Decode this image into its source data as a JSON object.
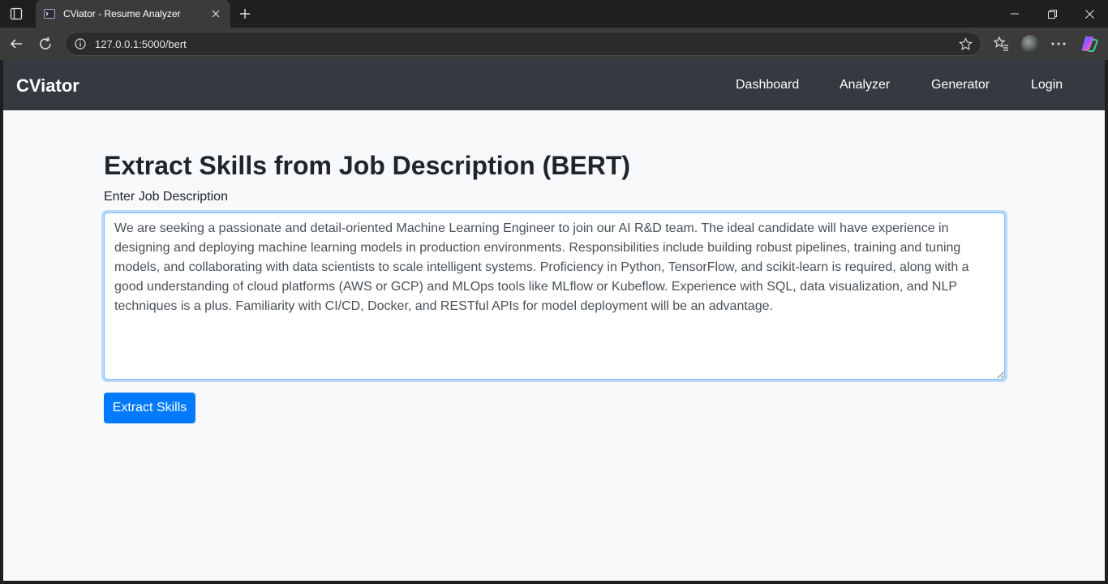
{
  "browser": {
    "tab_title": "CViator - Resume Analyzer",
    "url": "127.0.0.1:5000/bert"
  },
  "navbar": {
    "brand": "CViator",
    "links": [
      "Dashboard",
      "Analyzer",
      "Generator",
      "Login"
    ]
  },
  "page": {
    "heading": "Extract Skills from Job Description (BERT)",
    "textarea_label": "Enter Job Description",
    "job_description": "We are seeking a passionate and detail-oriented Machine Learning Engineer to join our AI R&D team. The ideal candidate will have experience in designing and deploying machine learning models in production environments. Responsibilities include building robust pipelines, training and tuning models, and collaborating with data scientists to scale intelligent systems. Proficiency in Python, TensorFlow, and scikit-learn is required, along with a good understanding of cloud platforms (AWS or GCP) and MLOps tools like MLflow or Kubeflow. Experience with SQL, data visualization, and NLP techniques is a plus. Familiarity with CI/CD, Docker, and RESTful APIs for model deployment will be an advantage.",
    "submit_label": "Extract Skills"
  },
  "colors": {
    "navbar_bg": "#343a40",
    "primary": "#007bff",
    "page_bg": "#f8f9fa"
  }
}
